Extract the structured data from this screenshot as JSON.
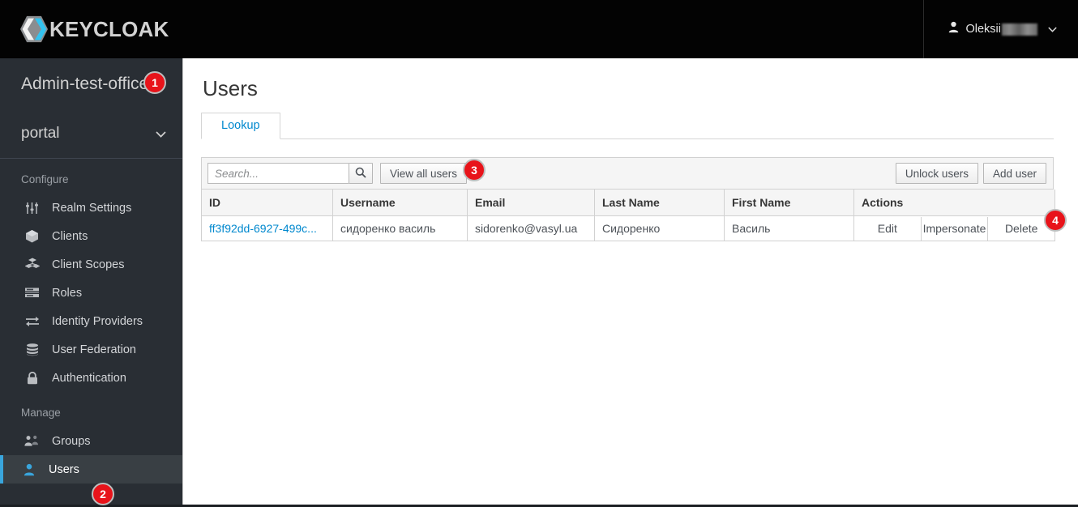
{
  "masthead": {
    "brand": "KEYCLOAK",
    "brand_logo_icon": "keycloak-hexagon-logo",
    "user_icon": "user-avatar-icon",
    "user_name": "Oleksii",
    "user_caret_icon": "chevron-down-icon"
  },
  "sidebar": {
    "realm_name": "Admin-test-officer-",
    "realm_selected": "portal",
    "realm_caret_icon": "chevron-down-icon",
    "sections": [
      {
        "label": "Configure",
        "items": [
          {
            "label": "Realm Settings",
            "icon": "sliders-icon",
            "active": false
          },
          {
            "label": "Clients",
            "icon": "cube-icon",
            "active": false
          },
          {
            "label": "Client Scopes",
            "icon": "cubes-icon",
            "active": false
          },
          {
            "label": "Roles",
            "icon": "list-bars-icon",
            "active": false
          },
          {
            "label": "Identity Providers",
            "icon": "exchange-arrows-icon",
            "active": false
          },
          {
            "label": "User Federation",
            "icon": "database-icon",
            "active": false
          },
          {
            "label": "Authentication",
            "icon": "lock-icon",
            "active": false
          }
        ]
      },
      {
        "label": "Manage",
        "items": [
          {
            "label": "Groups",
            "icon": "users-group-icon",
            "active": false
          },
          {
            "label": "Users",
            "icon": "user-icon",
            "active": true
          }
        ]
      }
    ]
  },
  "main": {
    "title": "Users",
    "tabs": [
      {
        "label": "Lookup",
        "active": true
      }
    ],
    "toolbar": {
      "search_placeholder": "Search...",
      "search_value": "",
      "search_icon": "magnifier-icon",
      "view_all_label": "View all users",
      "unlock_users_label": "Unlock users",
      "add_user_label": "Add user"
    },
    "table": {
      "columns": [
        "ID",
        "Username",
        "Email",
        "Last Name",
        "First Name",
        "Actions"
      ],
      "rows": [
        {
          "id": "ff3f92dd-6927-499c...",
          "username": "сидоренко василь",
          "email": "sidorenko@vasyl.ua",
          "last_name": "Сидоренко",
          "first_name": "Василь",
          "actions": [
            "Edit",
            "Impersonate",
            "Delete"
          ]
        }
      ]
    }
  },
  "annotations": {
    "badges": [
      {
        "number": "1",
        "target": "realm-name"
      },
      {
        "number": "2",
        "target": "sidebar-item-users"
      },
      {
        "number": "3",
        "target": "view-all-users-button"
      },
      {
        "number": "4",
        "target": "delete-action-button"
      }
    ]
  },
  "colors": {
    "masthead_bg": "#030303",
    "sidebar_bg": "#292e34",
    "accent_blue": "#0088ce",
    "active_border": "#39a5dc",
    "badge_red": "#e8131a"
  }
}
